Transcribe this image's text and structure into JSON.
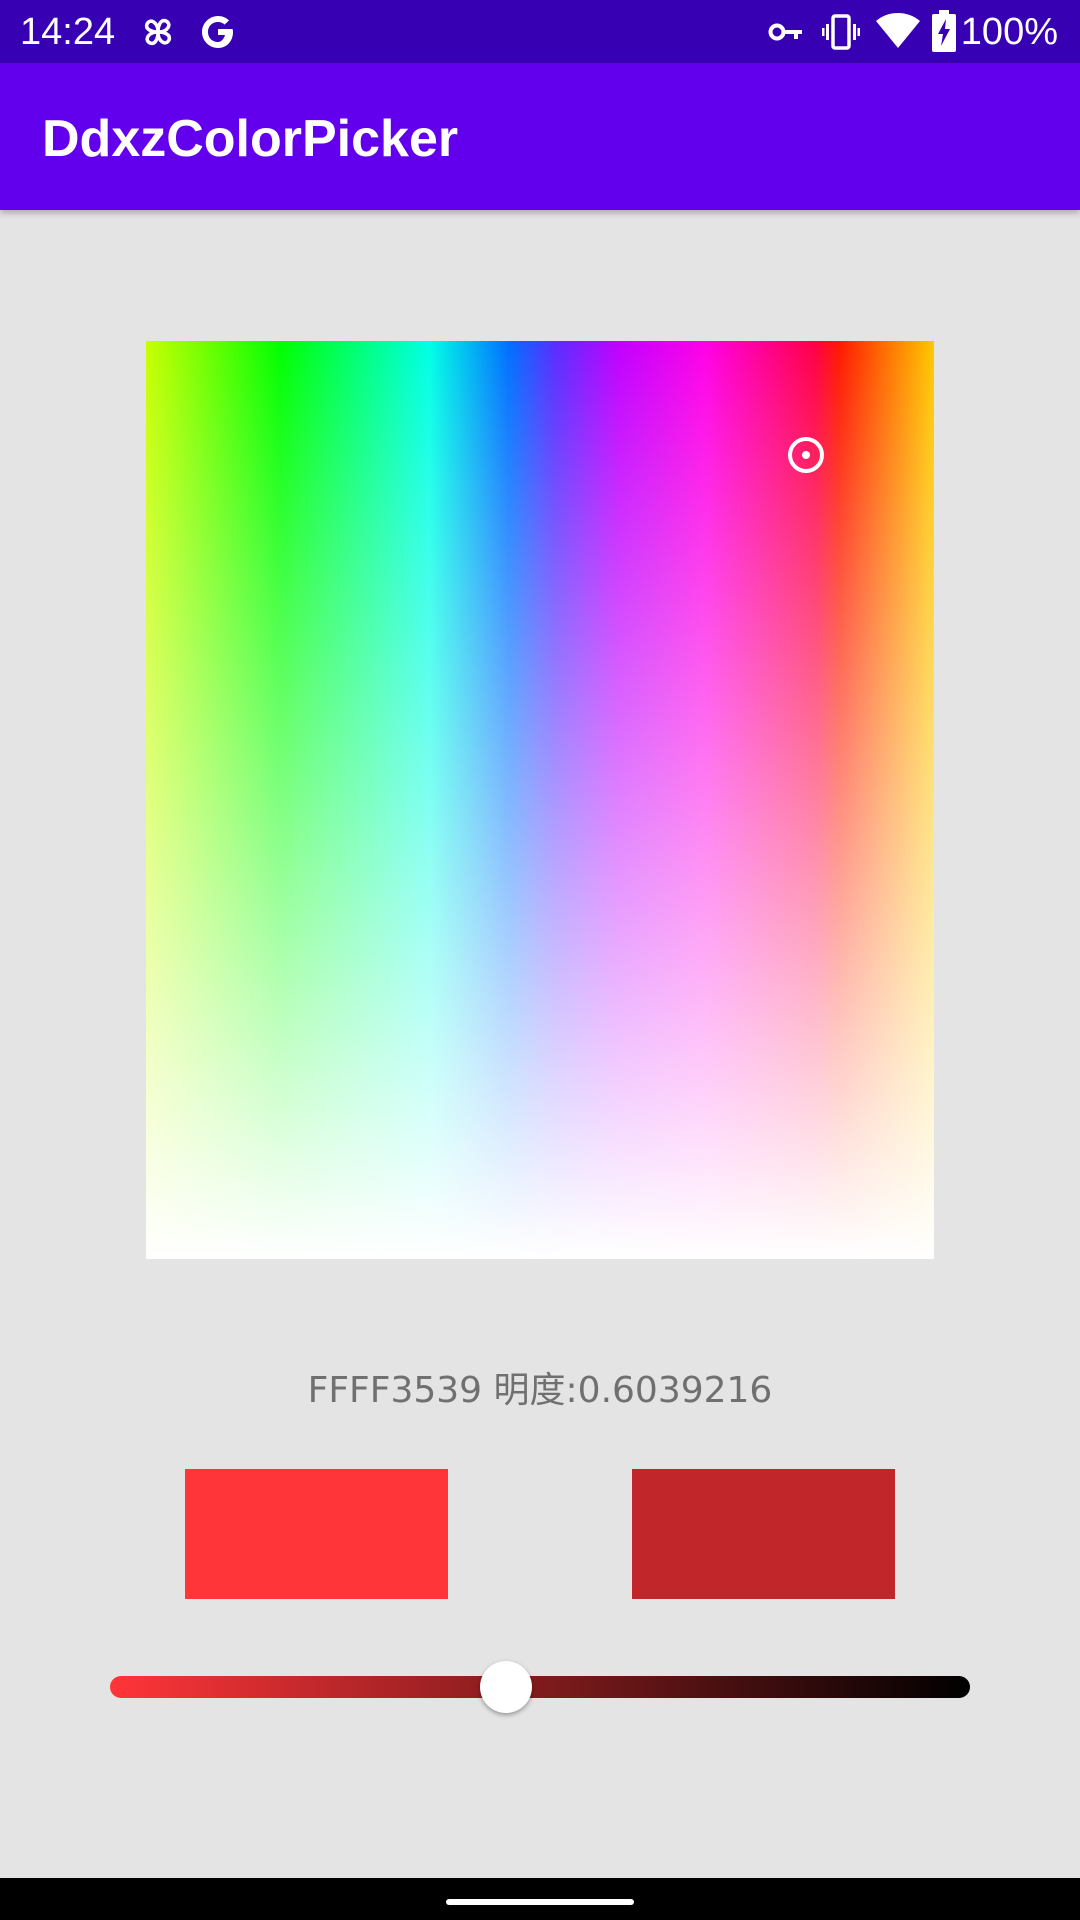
{
  "status_bar": {
    "time": "14:24",
    "left_icons": [
      "pinwheel-icon",
      "google-g-icon"
    ],
    "right_icons": [
      "vpn-key-icon",
      "vibrate-icon",
      "wifi-icon",
      "battery-charging-icon"
    ],
    "battery_text": "100%",
    "background": "#3700b3"
  },
  "app_bar": {
    "title": "DdxzColorPicker",
    "background": "#6200ee"
  },
  "color_picker": {
    "selected_hue_region": "red"
  },
  "color_info": {
    "text": "FFFF3539 明度:0.6039216"
  },
  "swatches": {
    "original_color": "#ff3539",
    "adjusted_color": "#c1272a"
  },
  "brightness_slider": {
    "value_fraction": 0.46,
    "start_color": "#ff3539",
    "end_color": "#000000"
  }
}
